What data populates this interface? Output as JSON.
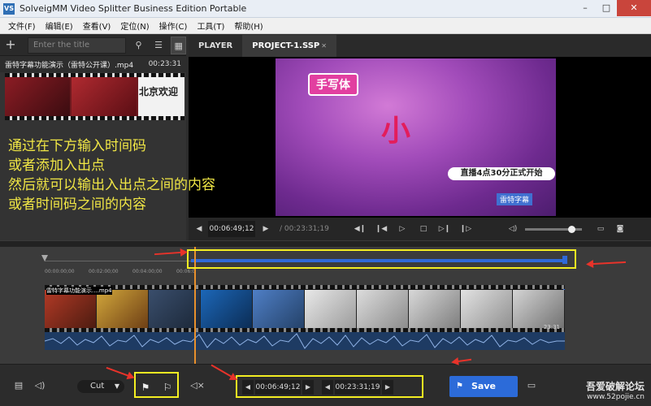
{
  "window": {
    "title": "SolveigMM Video Splitter Business Edition Portable",
    "logo": "VS",
    "min": "–",
    "max": "□",
    "close": "✕"
  },
  "menu": [
    {
      "label": "文件(F)"
    },
    {
      "label": "编辑(E)"
    },
    {
      "label": "查看(V)"
    },
    {
      "label": "定位(N)"
    },
    {
      "label": "操作(C)"
    },
    {
      "label": "工具(T)"
    },
    {
      "label": "帮助(H)"
    }
  ],
  "library": {
    "add_icon": "plus-icon",
    "search_placeholder": "Enter the title",
    "file": {
      "name": "雷特字幕功能演示（雷特公开课）.mp4",
      "duration": "00:23:31",
      "thumb_text": "北京欢迎",
      "thumb_time": "23:31"
    }
  },
  "annotation": {
    "line1": "通过在下方输入时间码",
    "line2": "或者添加入出点",
    "line3": "然后就可以输出入出点之间的内容",
    "line4": "或者时间码之间的内容",
    "color": "#f0e645"
  },
  "tabs": [
    {
      "label": "PLAYER"
    },
    {
      "label": "PROJECT-1.SSP"
    }
  ],
  "video": {
    "title_text": "手写体",
    "main_char": "小",
    "banner": "直播4点30分正式开始",
    "small_label": "雷特字幕"
  },
  "player": {
    "current_time": "00:06:49;12",
    "total_time": "/ 00:23:31;19"
  },
  "timeline": {
    "ticks": [
      "00:00:00;00",
      "00:02:00;00",
      "00:04:00;00",
      "00:06:0"
    ],
    "clip_label": "雷特字幕功能演示....mp4",
    "clip_time": "23:31",
    "playhead_color": "#e8902c",
    "range_color": "#2f69d8"
  },
  "toolbar": {
    "mode": "Cut",
    "start_time": "00:06:49;12",
    "end_time": "00:23:31;19",
    "save_label": "Save",
    "save_color": "#2c6bd9"
  },
  "watermark": {
    "line1": "吾爱破解论坛",
    "line2": "www.52pojie.cn"
  }
}
